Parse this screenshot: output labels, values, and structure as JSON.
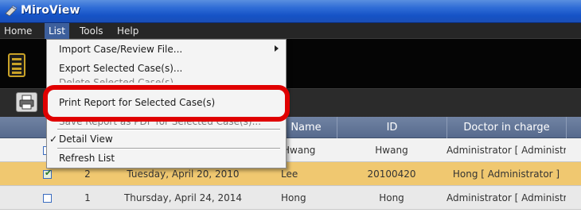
{
  "window": {
    "title": "MiroView"
  },
  "menubar": {
    "items": [
      "Home",
      "List",
      "Tools",
      "Help"
    ]
  },
  "list_menu": {
    "items": [
      "Import Case/Review File...",
      "Export Selected Case(s)...",
      "Delete Selected Case(s)",
      "Print Report for Selected Case(s)",
      "Save Report as PDF for Selected Case(s)...",
      "Detail View",
      "Refresh List"
    ],
    "detail_view_checked": true
  },
  "table": {
    "headers": [
      "Name",
      "ID",
      "Doctor in charge"
    ],
    "rows": [
      {
        "no": "",
        "date": "",
        "name": "Hwang",
        "id": "Hwang",
        "doctor": "Administrator [ Administr...",
        "checked": false,
        "selected": false
      },
      {
        "no": "2",
        "date": "Tuesday, April 20, 2010",
        "name": "Lee",
        "id": "20100420",
        "doctor": "Hong [ Administrator ]",
        "checked": true,
        "selected": true
      },
      {
        "no": "1",
        "date": "Thursday, April 24, 2014",
        "name": "Hong",
        "id": "Hong",
        "doctor": "Administrator [ Administr...",
        "checked": false,
        "selected": false
      }
    ]
  },
  "colors": {
    "accent": "#e00000",
    "selected_row": "#f0c870",
    "header": "#566a8d",
    "title_bar": "#1553c6"
  },
  "icons": [
    "app-logo-icon",
    "list-view-icon",
    "print-icon",
    "checkmark-icon",
    "submenu-arrow-icon"
  ]
}
